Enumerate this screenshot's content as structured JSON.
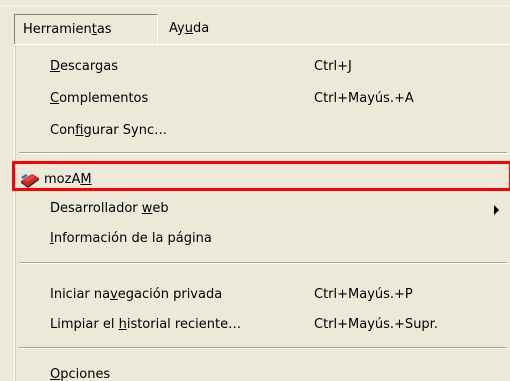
{
  "menubar": {
    "active_label_pre": "Herramien",
    "active_label_acc": "t",
    "active_label_post": "as",
    "help_label_pre": "Ay",
    "help_label_acc": "u",
    "help_label_post": "da"
  },
  "menu": {
    "downloads": {
      "pre": "",
      "acc": "D",
      "post": "escargas",
      "accel": "Ctrl+J"
    },
    "addons": {
      "pre": "",
      "acc": "C",
      "post": "omplementos",
      "accel": "Ctrl+Mayús.+A"
    },
    "sync": {
      "pre": "Con",
      "acc": "f",
      "post": "igurar Sync…",
      "accel": ""
    },
    "mozam": {
      "pre": "mozA",
      "acc": "M",
      "post": "",
      "accel": ""
    },
    "webdev": {
      "pre": "Desarrollador ",
      "acc": "w",
      "post": "eb",
      "accel": ""
    },
    "pageinfo": {
      "pre": "",
      "acc": "I",
      "post": "nformación de la página",
      "accel": ""
    },
    "private": {
      "pre": "Iniciar na",
      "acc": "v",
      "post": "egación privada",
      "accel": "Ctrl+Mayús.+P"
    },
    "clearhistory": {
      "pre": "Limpiar el ",
      "acc": "h",
      "post": "istorial reciente…",
      "accel": "Ctrl+Mayús.+Supr."
    },
    "options": {
      "pre": "",
      "acc": "O",
      "post": "pciones",
      "accel": ""
    }
  },
  "colors": {
    "menu_bg": "#ece9d8",
    "highlight_border": "#ff0000"
  }
}
